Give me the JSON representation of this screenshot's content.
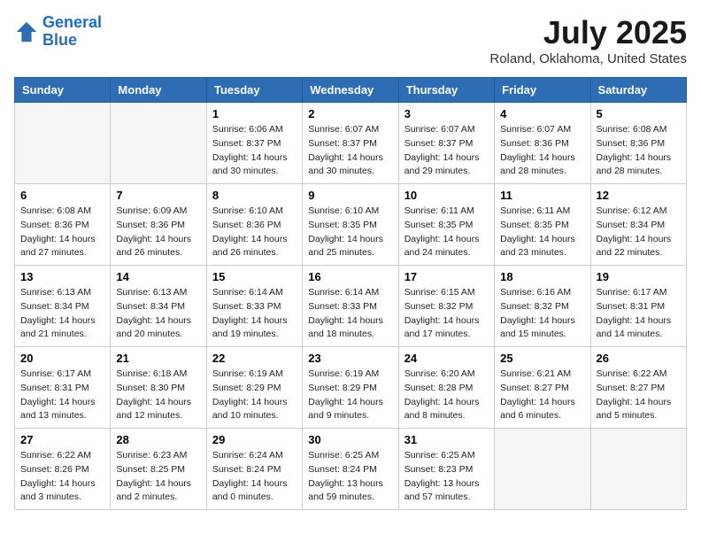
{
  "logo": {
    "line1": "General",
    "line2": "Blue"
  },
  "title": "July 2025",
  "location": "Roland, Oklahoma, United States",
  "weekdays": [
    "Sunday",
    "Monday",
    "Tuesday",
    "Wednesday",
    "Thursday",
    "Friday",
    "Saturday"
  ],
  "weeks": [
    [
      {
        "day": "",
        "info": ""
      },
      {
        "day": "",
        "info": ""
      },
      {
        "day": "1",
        "info": "Sunrise: 6:06 AM\nSunset: 8:37 PM\nDaylight: 14 hours\nand 30 minutes."
      },
      {
        "day": "2",
        "info": "Sunrise: 6:07 AM\nSunset: 8:37 PM\nDaylight: 14 hours\nand 30 minutes."
      },
      {
        "day": "3",
        "info": "Sunrise: 6:07 AM\nSunset: 8:37 PM\nDaylight: 14 hours\nand 29 minutes."
      },
      {
        "day": "4",
        "info": "Sunrise: 6:07 AM\nSunset: 8:36 PM\nDaylight: 14 hours\nand 28 minutes."
      },
      {
        "day": "5",
        "info": "Sunrise: 6:08 AM\nSunset: 8:36 PM\nDaylight: 14 hours\nand 28 minutes."
      }
    ],
    [
      {
        "day": "6",
        "info": "Sunrise: 6:08 AM\nSunset: 8:36 PM\nDaylight: 14 hours\nand 27 minutes."
      },
      {
        "day": "7",
        "info": "Sunrise: 6:09 AM\nSunset: 8:36 PM\nDaylight: 14 hours\nand 26 minutes."
      },
      {
        "day": "8",
        "info": "Sunrise: 6:10 AM\nSunset: 8:36 PM\nDaylight: 14 hours\nand 26 minutes."
      },
      {
        "day": "9",
        "info": "Sunrise: 6:10 AM\nSunset: 8:35 PM\nDaylight: 14 hours\nand 25 minutes."
      },
      {
        "day": "10",
        "info": "Sunrise: 6:11 AM\nSunset: 8:35 PM\nDaylight: 14 hours\nand 24 minutes."
      },
      {
        "day": "11",
        "info": "Sunrise: 6:11 AM\nSunset: 8:35 PM\nDaylight: 14 hours\nand 23 minutes."
      },
      {
        "day": "12",
        "info": "Sunrise: 6:12 AM\nSunset: 8:34 PM\nDaylight: 14 hours\nand 22 minutes."
      }
    ],
    [
      {
        "day": "13",
        "info": "Sunrise: 6:13 AM\nSunset: 8:34 PM\nDaylight: 14 hours\nand 21 minutes."
      },
      {
        "day": "14",
        "info": "Sunrise: 6:13 AM\nSunset: 8:34 PM\nDaylight: 14 hours\nand 20 minutes."
      },
      {
        "day": "15",
        "info": "Sunrise: 6:14 AM\nSunset: 8:33 PM\nDaylight: 14 hours\nand 19 minutes."
      },
      {
        "day": "16",
        "info": "Sunrise: 6:14 AM\nSunset: 8:33 PM\nDaylight: 14 hours\nand 18 minutes."
      },
      {
        "day": "17",
        "info": "Sunrise: 6:15 AM\nSunset: 8:32 PM\nDaylight: 14 hours\nand 17 minutes."
      },
      {
        "day": "18",
        "info": "Sunrise: 6:16 AM\nSunset: 8:32 PM\nDaylight: 14 hours\nand 15 minutes."
      },
      {
        "day": "19",
        "info": "Sunrise: 6:17 AM\nSunset: 8:31 PM\nDaylight: 14 hours\nand 14 minutes."
      }
    ],
    [
      {
        "day": "20",
        "info": "Sunrise: 6:17 AM\nSunset: 8:31 PM\nDaylight: 14 hours\nand 13 minutes."
      },
      {
        "day": "21",
        "info": "Sunrise: 6:18 AM\nSunset: 8:30 PM\nDaylight: 14 hours\nand 12 minutes."
      },
      {
        "day": "22",
        "info": "Sunrise: 6:19 AM\nSunset: 8:29 PM\nDaylight: 14 hours\nand 10 minutes."
      },
      {
        "day": "23",
        "info": "Sunrise: 6:19 AM\nSunset: 8:29 PM\nDaylight: 14 hours\nand 9 minutes."
      },
      {
        "day": "24",
        "info": "Sunrise: 6:20 AM\nSunset: 8:28 PM\nDaylight: 14 hours\nand 8 minutes."
      },
      {
        "day": "25",
        "info": "Sunrise: 6:21 AM\nSunset: 8:27 PM\nDaylight: 14 hours\nand 6 minutes."
      },
      {
        "day": "26",
        "info": "Sunrise: 6:22 AM\nSunset: 8:27 PM\nDaylight: 14 hours\nand 5 minutes."
      }
    ],
    [
      {
        "day": "27",
        "info": "Sunrise: 6:22 AM\nSunset: 8:26 PM\nDaylight: 14 hours\nand 3 minutes."
      },
      {
        "day": "28",
        "info": "Sunrise: 6:23 AM\nSunset: 8:25 PM\nDaylight: 14 hours\nand 2 minutes."
      },
      {
        "day": "29",
        "info": "Sunrise: 6:24 AM\nSunset: 8:24 PM\nDaylight: 14 hours\nand 0 minutes."
      },
      {
        "day": "30",
        "info": "Sunrise: 6:25 AM\nSunset: 8:24 PM\nDaylight: 13 hours\nand 59 minutes."
      },
      {
        "day": "31",
        "info": "Sunrise: 6:25 AM\nSunset: 8:23 PM\nDaylight: 13 hours\nand 57 minutes."
      },
      {
        "day": "",
        "info": ""
      },
      {
        "day": "",
        "info": ""
      }
    ]
  ]
}
